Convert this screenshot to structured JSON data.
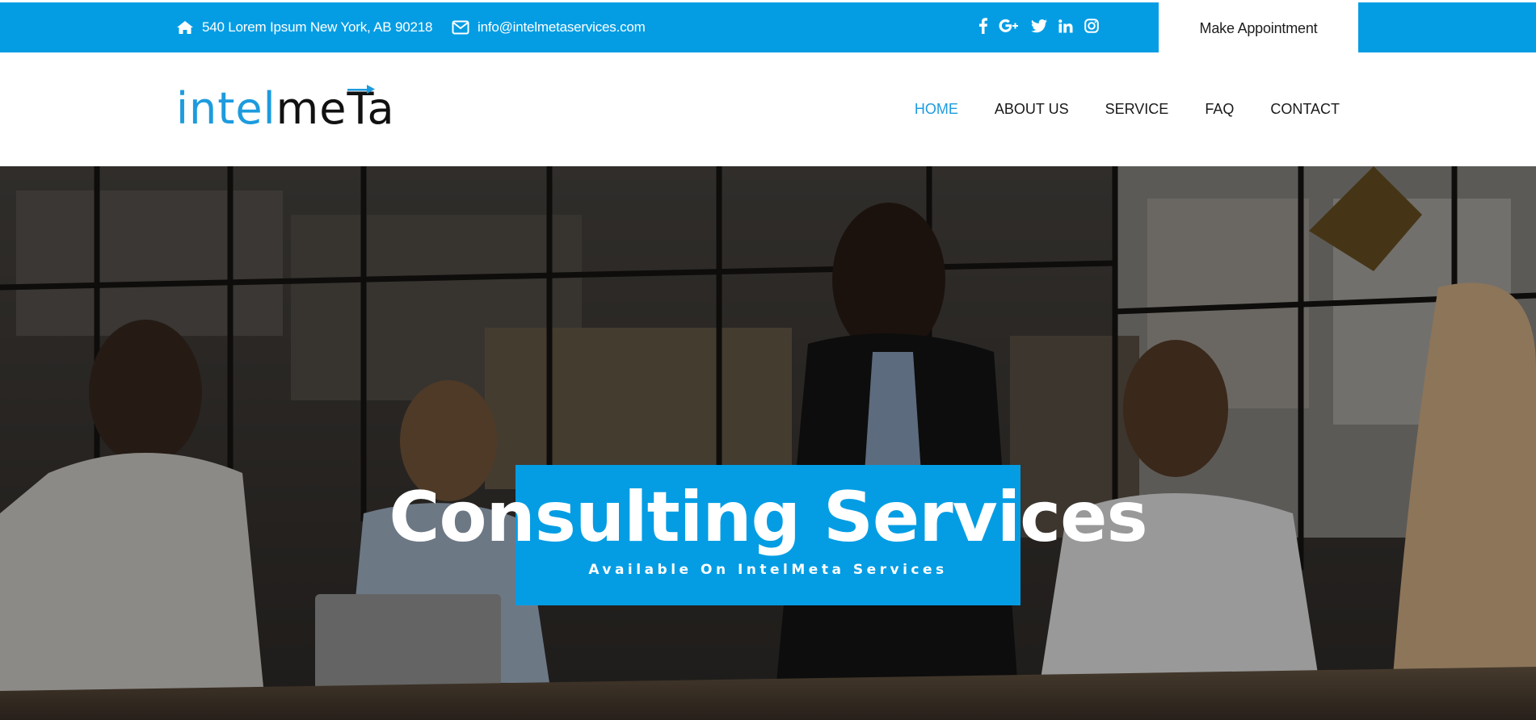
{
  "topbar": {
    "address": "540 Lorem Ipsum New York, AB 90218",
    "email": "info@intelmetaservices.com",
    "socials": [
      "facebook-icon",
      "google-plus-icon",
      "twitter-icon",
      "linkedin-icon",
      "instagram-icon"
    ],
    "appointment_label": "Make Appointment"
  },
  "logo": {
    "part1": "intel",
    "part2": "meTa"
  },
  "nav": {
    "items": [
      "HOME",
      "ABOUT US",
      "SERVICE",
      "FAQ",
      "CONTACT"
    ],
    "active": "HOME"
  },
  "hero": {
    "title": "Consulting Services",
    "subtitle": "Available On IntelMeta Services"
  },
  "colors": {
    "brand_blue": "#049de4",
    "logo_blue": "#1d9bde",
    "text_dark": "#1a1a1a"
  }
}
